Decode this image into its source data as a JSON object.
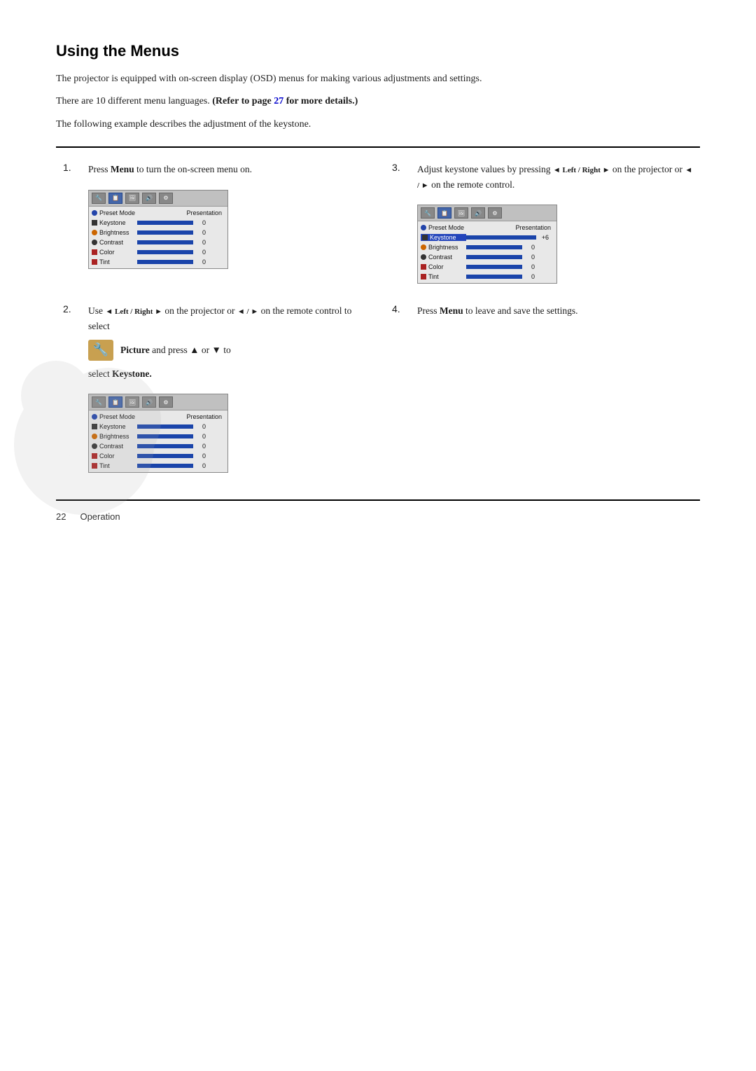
{
  "page": {
    "title": "Using the Menus",
    "intro": "The projector is equipped with on-screen display (OSD) menus for making various adjustments and settings.",
    "refer_prefix": "There are 10 different menu languages. ",
    "refer_bold": "(Refer to page ",
    "refer_link": "27",
    "refer_suffix": " for more details.)",
    "example": "The following example describes the adjustment of the keystone.",
    "footer_number": "22",
    "footer_section": "Operation"
  },
  "steps": [
    {
      "number": "1.",
      "text_parts": [
        "Press ",
        "Menu",
        " to turn the on-screen menu on."
      ]
    },
    {
      "number": "2.",
      "text_parts": [
        "Use ",
        "◄ Left / Right ►",
        " on the projector or ",
        "◄ / ►",
        " on the remote control to select "
      ],
      "picture_text": "Picture",
      "press_text": " and press ▲ or ▼ to",
      "select_text": "select ",
      "select_bold": "Keystone."
    },
    {
      "number": "3.",
      "text_parts": [
        "Adjust keystone values by pressing ",
        "◄ Left / Right ►",
        " on the projector or ",
        "◄ / ►",
        " on the remote control."
      ]
    },
    {
      "number": "4.",
      "text_parts": [
        "Press ",
        "Menu",
        " to leave and save the settings."
      ]
    }
  ],
  "osd_menus": {
    "preset_label": "Preset Mode",
    "presentation_label": "Presentation",
    "rows": [
      {
        "label": "Keystone",
        "dot": "blue",
        "value": "0"
      },
      {
        "label": "Brightness",
        "dot": "orange",
        "value": "0"
      },
      {
        "label": "Contrast",
        "dot": "dark",
        "value": "0"
      },
      {
        "label": "Color",
        "dot": "red",
        "value": "0"
      },
      {
        "label": "Tint",
        "dot": "red",
        "value": "0"
      }
    ],
    "keystone_adjusted_value": "+6"
  },
  "icons": {
    "toolbar_1": "🔧",
    "toolbar_2": "📋",
    "toolbar_3": "🖼",
    "toolbar_4": "🔊",
    "toolbar_5": "⚙"
  }
}
